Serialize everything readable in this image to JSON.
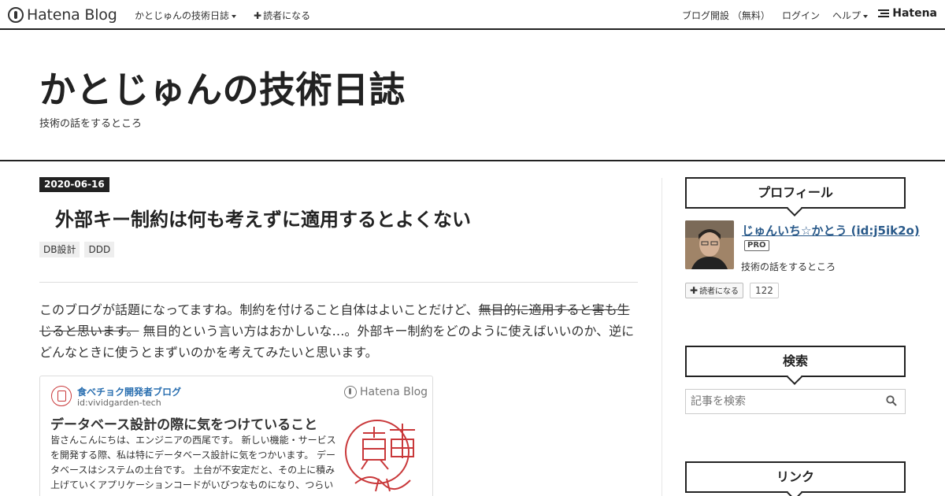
{
  "global_header": {
    "logo_text": "Hatena Blog",
    "blog_menu_label": "かとじゅんの技術日誌",
    "subscribe_label": "読者になる",
    "open_blog_label": "ブログ開設 （無料）",
    "login_label": "ログイン",
    "help_label": "ヘルプ",
    "hatena_label": "Hatena"
  },
  "blog_header": {
    "title": "かとじゅんの技術日誌",
    "description": "技術の話をするところ"
  },
  "entry": {
    "date": "2020-06-16",
    "title": "外部キー制約は何も考えずに適用するとよくない",
    "categories": [
      "DB設計",
      "DDD"
    ],
    "body_part1": "このブログが話題になってますね。制約を付けること自体はよいことだけど、",
    "body_strike": "無目的に適用すると害も生じると思います。",
    "body_part2": " 無目的という言い方はおかしいな…。外部キー制約をどのように使えばいいのか、逆にどんなときに使うとまずいのかを考えてみたいと思います。"
  },
  "embed": {
    "blog_name": "食べチョク開発者ブログ",
    "blog_id": "id:vividgarden-tech",
    "service_label": "Hatena Blog",
    "title": "データベース設計の際に気をつけていること",
    "summary": "皆さんこんにちは、エンジニアの西尾です。 新しい機能・サービスを開発する際、私は特にデータベース設計に気をつかいます。 データベースはシステムの土台です。 土台が不安定だと、その上に積み上げていくアプリケーションコードがいびつなものになり、つらい"
  },
  "sidebar": {
    "profile_title": "プロフィール",
    "profile_name": "じゅんいち☆かとう (id:j5ik2o)",
    "pro_badge": "PRO",
    "profile_desc": "技術の話をするところ",
    "subscribe_label": "読者になる",
    "subscriber_count": "122",
    "search_title": "検索",
    "search_placeholder": "記事を検索",
    "links_title": "リンク"
  },
  "colors": {
    "text": "#222222",
    "link": "#2a5a8a",
    "embed_blog": "#2a6fb0",
    "logo_red": "#c9383a"
  },
  "icons": [
    "hatena-blog-logo-icon",
    "caret-down-icon",
    "plus-icon",
    "hatena-stripe-icon",
    "search-icon",
    "shokuchoku-logo-icon"
  ]
}
